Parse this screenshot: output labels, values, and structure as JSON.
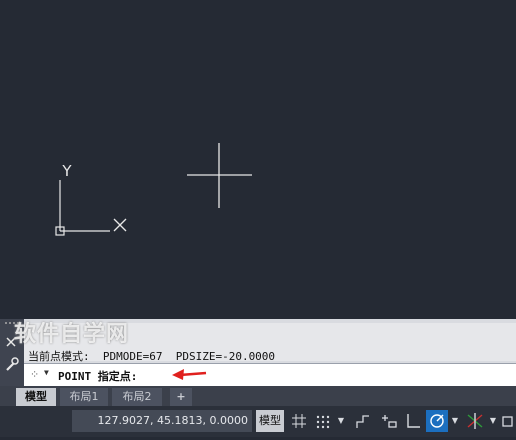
{
  "command_history": {
    "line1": "",
    "line2": "当前点模式:  PDMODE=67  PDSIZE=-20.0000"
  },
  "command_input": {
    "prompt": "POINT 指定点:"
  },
  "watermark": "软件自学网",
  "tabs": [
    {
      "label": "模型",
      "active": true
    },
    {
      "label": "布局1",
      "active": false
    },
    {
      "label": "布局2",
      "active": false
    },
    {
      "label": "+",
      "active": false
    }
  ],
  "status": {
    "coordinates": "127.9027, 45.1813, 0.0000",
    "model_label": "模型"
  },
  "ucs": {
    "x_label": "X",
    "y_label": "Y"
  },
  "colors": {
    "canvas": "#252a34",
    "arrow": "#e0201e",
    "active_toggle": "#1c6fbf"
  }
}
